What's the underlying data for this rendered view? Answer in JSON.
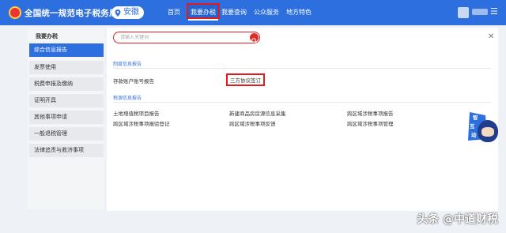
{
  "header": {
    "site_title": "全国统一规范电子税务局",
    "region": "安徽",
    "nav": [
      "首页",
      "我要办税",
      "我要查询",
      "公众服务",
      "地方特色"
    ]
  },
  "sidebar": {
    "title": "我要办税",
    "items": [
      "综合信息报告",
      "发票使用",
      "税费申报及缴纳",
      "证明开具",
      "其他事项申请",
      "一般退税管理",
      "法律追责与救济事项"
    ]
  },
  "main": {
    "search_placeholder": "请输入关键词",
    "section1_title": "制度信息报告",
    "section1_items": [
      "存款账户账号报告",
      "三方协议签订"
    ],
    "section2_title": "税源信息报告",
    "section2_items": [
      "土地增值税项目报告",
      "新建商品房房源信息采集",
      "跨区域涉税事项报告",
      "跨区域涉税事项报验登记",
      "跨区域涉税事项反馈",
      "跨区域涉税事项管理"
    ]
  },
  "assistant": {
    "label1": "智",
    "label2": "互",
    "label3": "动"
  },
  "watermark": "头条 @中道财税",
  "colors": {
    "brand_blue": "#2e6fe0",
    "highlight_red": "#e21c1c"
  }
}
